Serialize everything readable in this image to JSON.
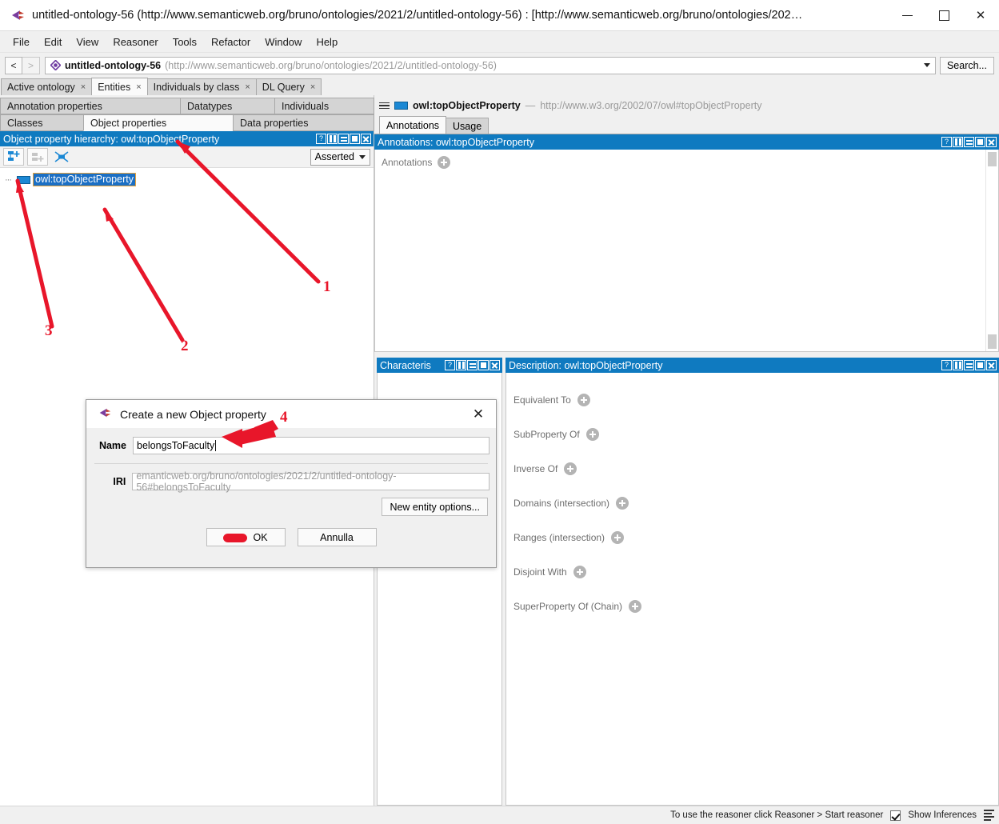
{
  "window": {
    "title": "untitled-ontology-56 (http://www.semanticweb.org/bruno/ontologies/2021/2/untitled-ontology-56)  : [http://www.semanticweb.org/bruno/ontologies/202…",
    "app_icon": "protege-icon",
    "minimize": "minimize-icon",
    "maximize": "maximize-icon",
    "close": "close-icon"
  },
  "menubar": {
    "items": [
      "File",
      "Edit",
      "View",
      "Reasoner",
      "Tools",
      "Refactor",
      "Window",
      "Help"
    ]
  },
  "toolbar": {
    "back": "<",
    "forward": ">",
    "ontology_icon": "ontology-diamond-icon",
    "ontology_name": "untitled-ontology-56",
    "ontology_iri": "(http://www.semanticweb.org/bruno/ontologies/2021/2/untitled-ontology-56)",
    "search_label": "Search..."
  },
  "main_tabs": [
    {
      "label": "Active ontology",
      "closable": true,
      "active": false
    },
    {
      "label": "Entities",
      "closable": true,
      "active": true
    },
    {
      "label": "Individuals by class",
      "closable": true,
      "active": false
    },
    {
      "label": "DL Query",
      "closable": true,
      "active": false
    }
  ],
  "entity_subtabs": {
    "row1": [
      {
        "label": "Annotation properties",
        "active": false
      },
      {
        "label": "Datatypes",
        "active": false
      },
      {
        "label": "Individuals",
        "active": false
      }
    ],
    "row2": [
      {
        "label": "Classes",
        "active": false
      },
      {
        "label": "Object properties",
        "active": true
      },
      {
        "label": "Data properties",
        "active": false
      }
    ]
  },
  "hierarchy_panel": {
    "title": "Object property hierarchy: owl:topObjectProperty",
    "header_icons": [
      "help-icon",
      "split-icon",
      "minimize-icon",
      "maximize-icon",
      "close-icon"
    ],
    "toolbar": {
      "add_sub_property": "add-sub-property-icon",
      "add_sibling_property": "add-sibling-property-icon",
      "delete_property": "delete-property-icon",
      "view_mode": "Asserted"
    },
    "tree": [
      {
        "label": "owl:topObjectProperty",
        "selected": true,
        "icon": "object-property-icon"
      }
    ]
  },
  "entity_header": {
    "menu_icon": "hamburger-icon",
    "entity_icon": "object-property-icon",
    "entity_name": "owl:topObjectProperty",
    "separator": "—",
    "entity_iri": "http://www.w3.org/2002/07/owl#topObjectProperty"
  },
  "entity_tabs": [
    {
      "label": "Annotations",
      "active": true
    },
    {
      "label": "Usage",
      "active": false
    }
  ],
  "annotations_panel": {
    "title": "Annotations: owl:topObjectProperty",
    "header_icons": [
      "help-icon",
      "split-icon",
      "minimize-icon",
      "maximize-icon",
      "close-icon"
    ],
    "add_label": "Annotations",
    "add_button": "add-annotation-icon"
  },
  "characteristics_panel": {
    "title": "Characteris",
    "header_icons": [
      "help-icon",
      "split-icon",
      "minimize-icon",
      "maximize-icon",
      "close-icon"
    ]
  },
  "description_panel": {
    "title": "Description: owl:topObjectProperty",
    "header_icons": [
      "help-icon",
      "split-icon",
      "minimize-icon",
      "maximize-icon",
      "close-icon"
    ],
    "rows": [
      {
        "label": "Equivalent To",
        "add": "add-equivalent-to-icon"
      },
      {
        "label": "SubProperty Of",
        "add": "add-subproperty-of-icon"
      },
      {
        "label": "Inverse Of",
        "add": "add-inverse-of-icon"
      },
      {
        "label": "Domains (intersection)",
        "add": "add-domains-icon"
      },
      {
        "label": "Ranges (intersection)",
        "add": "add-ranges-icon"
      },
      {
        "label": "Disjoint With",
        "add": "add-disjoint-with-icon"
      },
      {
        "label": "SuperProperty Of (Chain)",
        "add": "add-superproperty-chain-icon"
      }
    ]
  },
  "statusbar": {
    "reasoner_hint": "To use the reasoner click Reasoner > Start reasoner",
    "show_inferences_label": "Show Inferences",
    "show_inferences_checked": true,
    "log_icon": "log-list-icon"
  },
  "dialog": {
    "icon": "protege-icon",
    "title": "Create a new Object property",
    "close": "close-icon",
    "name_label": "Name",
    "name_value": "belongsToFaculty",
    "iri_label": "IRI",
    "iri_value": "emanticweb.org/bruno/ontologies/2021/2/untitled-ontology-56#belongsToFaculty",
    "new_entity_options_label": "New entity options...",
    "ok_label": "OK",
    "cancel_label": "Annulla"
  },
  "annotations_overlay": {
    "color": "#e8162a",
    "markers": [
      {
        "number": "1",
        "target": "object-properties-tab"
      },
      {
        "number": "2",
        "target": "owl-topobjectproperty-tree-node"
      },
      {
        "number": "3",
        "target": "add-sub-property-button"
      },
      {
        "number": "4",
        "target": "name-input"
      }
    ]
  }
}
